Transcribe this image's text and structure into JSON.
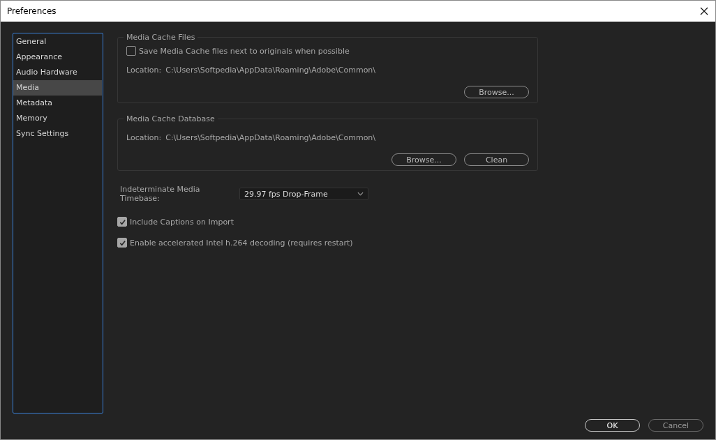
{
  "window": {
    "title": "Preferences"
  },
  "sidebar": {
    "items": [
      {
        "label": "General",
        "selected": false
      },
      {
        "label": "Appearance",
        "selected": false
      },
      {
        "label": "Audio Hardware",
        "selected": false
      },
      {
        "label": "Media",
        "selected": true
      },
      {
        "label": "Metadata",
        "selected": false
      },
      {
        "label": "Memory",
        "selected": false
      },
      {
        "label": "Sync Settings",
        "selected": false
      }
    ]
  },
  "groups": [
    {
      "title": "Media Cache Files",
      "checkbox": {
        "label": "Save Media Cache files next to originals when possible",
        "checked": false
      },
      "location": {
        "label": "Location:",
        "path": "C:\\Users\\Softpedia\\AppData\\Roaming\\Adobe\\Common\\"
      },
      "buttons": [
        "Browse..."
      ]
    },
    {
      "title": "Media Cache Database",
      "location": {
        "label": "Location:",
        "path": "C:\\Users\\Softpedia\\AppData\\Roaming\\Adobe\\Common\\"
      },
      "buttons": [
        "Browse...",
        "Clean"
      ]
    }
  ],
  "timebase": {
    "label": "Indeterminate Media Timebase:",
    "value": "29.97 fps Drop-Frame"
  },
  "options": [
    {
      "label": "Include Captions on Import",
      "checked": true
    },
    {
      "label": "Enable accelerated Intel h.264 decoding (requires restart)",
      "checked": true
    }
  ],
  "buttons": [
    {
      "label": "OK",
      "kind": "default"
    },
    {
      "label": "Cancel",
      "kind": "secondary"
    }
  ]
}
